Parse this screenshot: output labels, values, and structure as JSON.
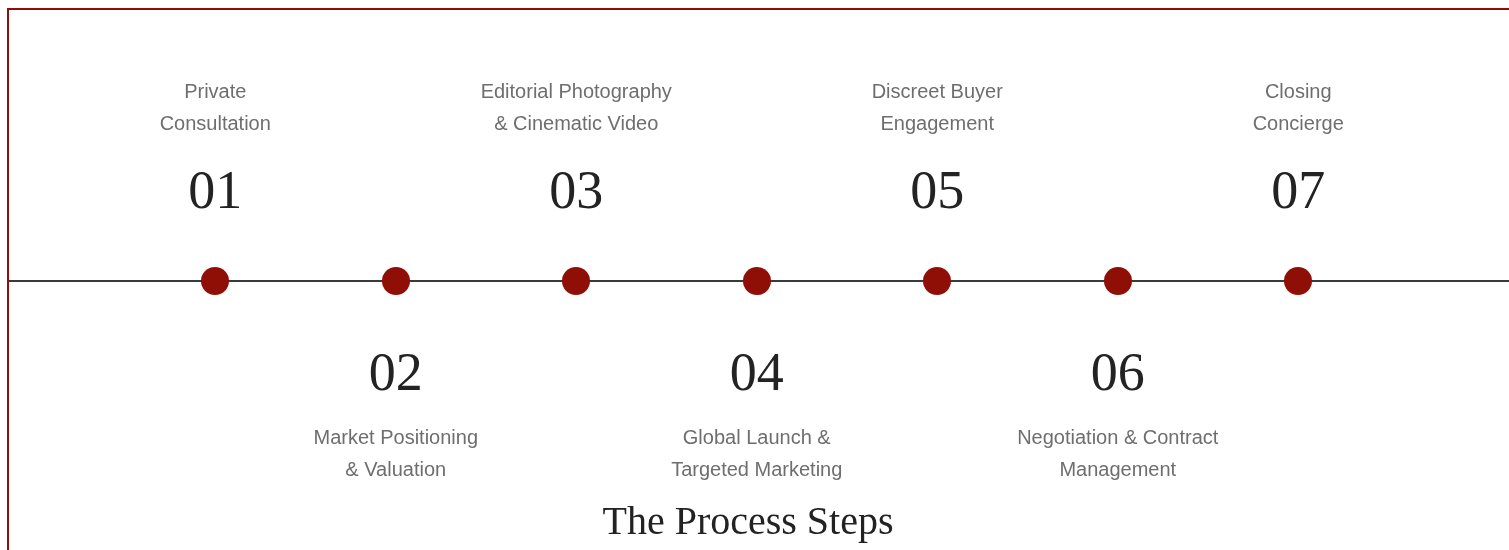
{
  "steps": [
    {
      "number": "01",
      "lines": [
        "Private",
        "Consultation"
      ],
      "kind": "above"
    },
    {
      "number": "02",
      "lines": [
        "Market Positioning",
        "& Valuation"
      ],
      "kind": "below"
    },
    {
      "number": "03",
      "lines": [
        "Editorial Photography",
        "& Cinematic Video"
      ],
      "kind": "above"
    },
    {
      "number": "04",
      "lines": [
        "Global Launch &",
        "Targeted Marketing"
      ],
      "kind": "below"
    },
    {
      "number": "05",
      "lines": [
        "Discreet Buyer",
        "Engagement"
      ],
      "kind": "above"
    },
    {
      "number": "06",
      "lines": [
        "Negotiation & Contract",
        "Management"
      ],
      "kind": "below"
    },
    {
      "number": "07",
      "lines": [
        "Closing",
        "Concierge"
      ],
      "kind": "above"
    }
  ],
  "title": "The Process Steps"
}
